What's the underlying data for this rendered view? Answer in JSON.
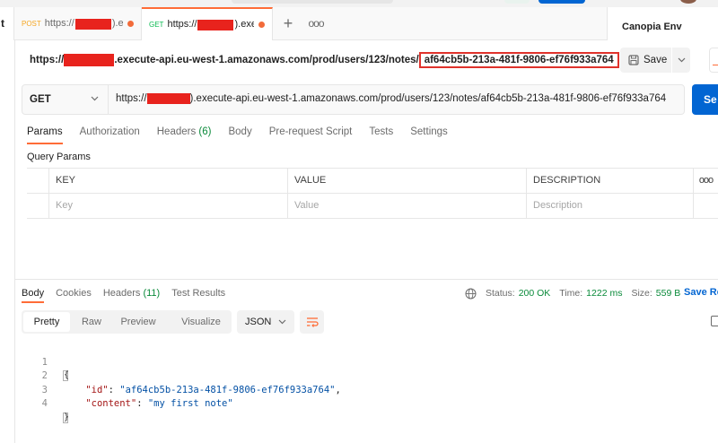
{
  "tabbar": {
    "side_label": "t",
    "tabs": [
      {
        "method": "POST",
        "text_prefix": "https://",
        "text_suffix": ").exe",
        "dirty": true
      },
      {
        "method": "GET",
        "text_prefix": "https://",
        "text_suffix": ").exe",
        "dirty": true
      }
    ],
    "add_tab": "+",
    "more": "ooo",
    "environment": "Canopia Env"
  },
  "title": {
    "url_prefix": "https://",
    "url_middle": ".execute-api.eu-west-1.amazonaws.com/prod/users/123/notes/",
    "url_highlight": "af64cb5b-213a-481f-9806-ef76f933a764",
    "save_label": "Save"
  },
  "request": {
    "method": "GET",
    "url_prefix": "https://",
    "url_rest": ").execute-api.eu-west-1.amazonaws.com/prod/users/123/notes/af64cb5b-213a-481f-9806-ef76f933a764",
    "send_label": "Se",
    "tabs": [
      {
        "label": "Params",
        "count": ""
      },
      {
        "label": "Authorization",
        "count": ""
      },
      {
        "label": "Headers",
        "count": "(6)"
      },
      {
        "label": "Body",
        "count": ""
      },
      {
        "label": "Pre-request Script",
        "count": ""
      },
      {
        "label": "Tests",
        "count": ""
      },
      {
        "label": "Settings",
        "count": ""
      }
    ],
    "query_params_label": "Query Params",
    "table": {
      "headers": [
        "KEY",
        "VALUE",
        "DESCRIPTION",
        "ooo"
      ],
      "placeholders": [
        "Key",
        "Value",
        "Description"
      ]
    }
  },
  "response": {
    "tabs": [
      {
        "label": "Body",
        "count": ""
      },
      {
        "label": "Cookies",
        "count": ""
      },
      {
        "label": "Headers",
        "count": "(11)"
      },
      {
        "label": "Test Results",
        "count": ""
      }
    ],
    "status_label": "Status:",
    "status_value": "200 OK",
    "time_label": "Time:",
    "time_value": "1222 ms",
    "size_label": "Size:",
    "size_value": "559 B",
    "save_response": "Save Re",
    "formats": [
      "Pretty",
      "Raw",
      "Preview",
      "Visualize"
    ],
    "language": "JSON",
    "code": {
      "line_numbers": [
        "1",
        "2",
        "3",
        "4"
      ],
      "open_brace": "{",
      "close_brace": "}",
      "id_key": "\"id\"",
      "id_value": "\"af64cb5b-213a-481f-9806-ef76f933a764\"",
      "content_key": "\"content\"",
      "content_value": "\"my first note\""
    }
  },
  "colors": {
    "accent": "#ff6c37",
    "primary": "#0265d2",
    "success": "#0a8a3a",
    "redaction": "#e8231d"
  }
}
